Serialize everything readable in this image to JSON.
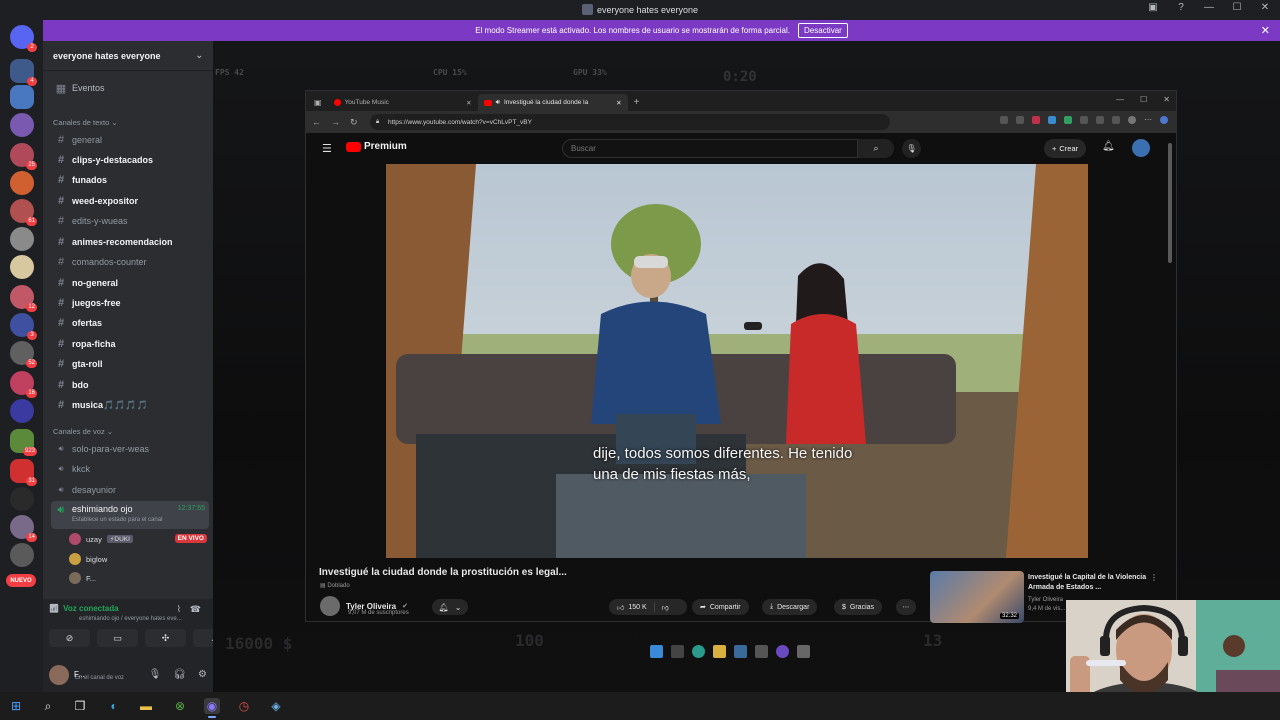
{
  "window": {
    "title": "everyone hates everyone",
    "controls": [
      "inbox-icon",
      "help-icon",
      "minimize-icon",
      "maximize-icon",
      "close-icon"
    ]
  },
  "streamer_banner": {
    "text": "El modo Streamer está activado. Los nombres de usuario se mostrarán de forma parcial.",
    "button": "Desactivar",
    "bg": "#7c3ac4"
  },
  "server_rail": {
    "badges": [
      "2",
      "4",
      "25",
      "61",
      "12",
      "3",
      "52",
      "16",
      "923",
      "31",
      "14"
    ],
    "new_label": "NUEVO"
  },
  "guild": {
    "name": "everyone hates everyone",
    "events": "Eventos",
    "text_category": "Canales de texto",
    "text_channels": [
      {
        "name": "general",
        "unread": false
      },
      {
        "name": "clips-y-destacados",
        "unread": true
      },
      {
        "name": "funados",
        "unread": true
      },
      {
        "name": "weed-expositor",
        "unread": true
      },
      {
        "name": "edits-y-wueas",
        "unread": false
      },
      {
        "name": "animes-recomendacion",
        "unread": true
      },
      {
        "name": "comandos-counter",
        "unread": false
      },
      {
        "name": "no-general",
        "unread": true
      },
      {
        "name": "juegos-free",
        "unread": true
      },
      {
        "name": "ofertas",
        "unread": true
      },
      {
        "name": "ropa-ficha",
        "unread": true
      },
      {
        "name": "gta-roll",
        "unread": true
      },
      {
        "name": "bdo",
        "unread": true
      },
      {
        "name": "musica🎵🎵🎵🎵",
        "unread": true
      }
    ],
    "voice_category": "Canales de voz",
    "voice_channels": [
      {
        "name": "solo-para-ver-weas"
      },
      {
        "name": "kkck"
      },
      {
        "name": "desayunior"
      }
    ],
    "active_voice": {
      "name": "eshimiando ojo",
      "time": "12:37:55",
      "status": "Establece un estado para el canal"
    },
    "voice_users": [
      {
        "name": "uzay",
        "extra": "⚡DUKI",
        "live": "EN VIVO",
        "color": "#b04a6a"
      },
      {
        "name": "biglow",
        "color": "#c8a040"
      },
      {
        "name": "F...",
        "color": "#7a6a5a"
      }
    ]
  },
  "voice_panel": {
    "status": "Voz conectada",
    "detail": "eshimiando ojo / everyone hates eve...",
    "status_color": "#23a55a"
  },
  "user": {
    "name": "F...",
    "status": "En el canal de voz"
  },
  "browser": {
    "tabs": [
      {
        "label": "YouTube Music",
        "active": false
      },
      {
        "label": "Investigué la ciudad donde la",
        "active": true
      }
    ],
    "url": "https://www.youtube.com/watch?v=vChLvPT_vBY"
  },
  "youtube": {
    "logo": "Premium",
    "search_placeholder": "Buscar",
    "create": "Crear",
    "subtitle_line1": "dije, todos somos diferentes. He tenido",
    "subtitle_line2": "una de mis fiestas más,",
    "video_title": "Investigué la ciudad donde la prostitución es legal...",
    "dubbed": "Doblado",
    "channel": "Tyler Oliveira",
    "subscribers": "9,07 M de suscriptores",
    "likes": "150 K",
    "share": "Compartir",
    "download": "Descargar",
    "thanks": "Gracias",
    "rec": {
      "title": "Investigué la Capital de la Violencia Armada de Estados ...",
      "channel": "Tyler Oliveira",
      "views": "9,4 M de vis...",
      "duration": "32:32"
    }
  },
  "game_hud": {
    "fps": "FPS 42",
    "cpu": "CPU 15%",
    "gpu": "GPU 33%",
    "timer": "0:20",
    "money": "16000 $",
    "health": "100",
    "ammo": "13"
  }
}
